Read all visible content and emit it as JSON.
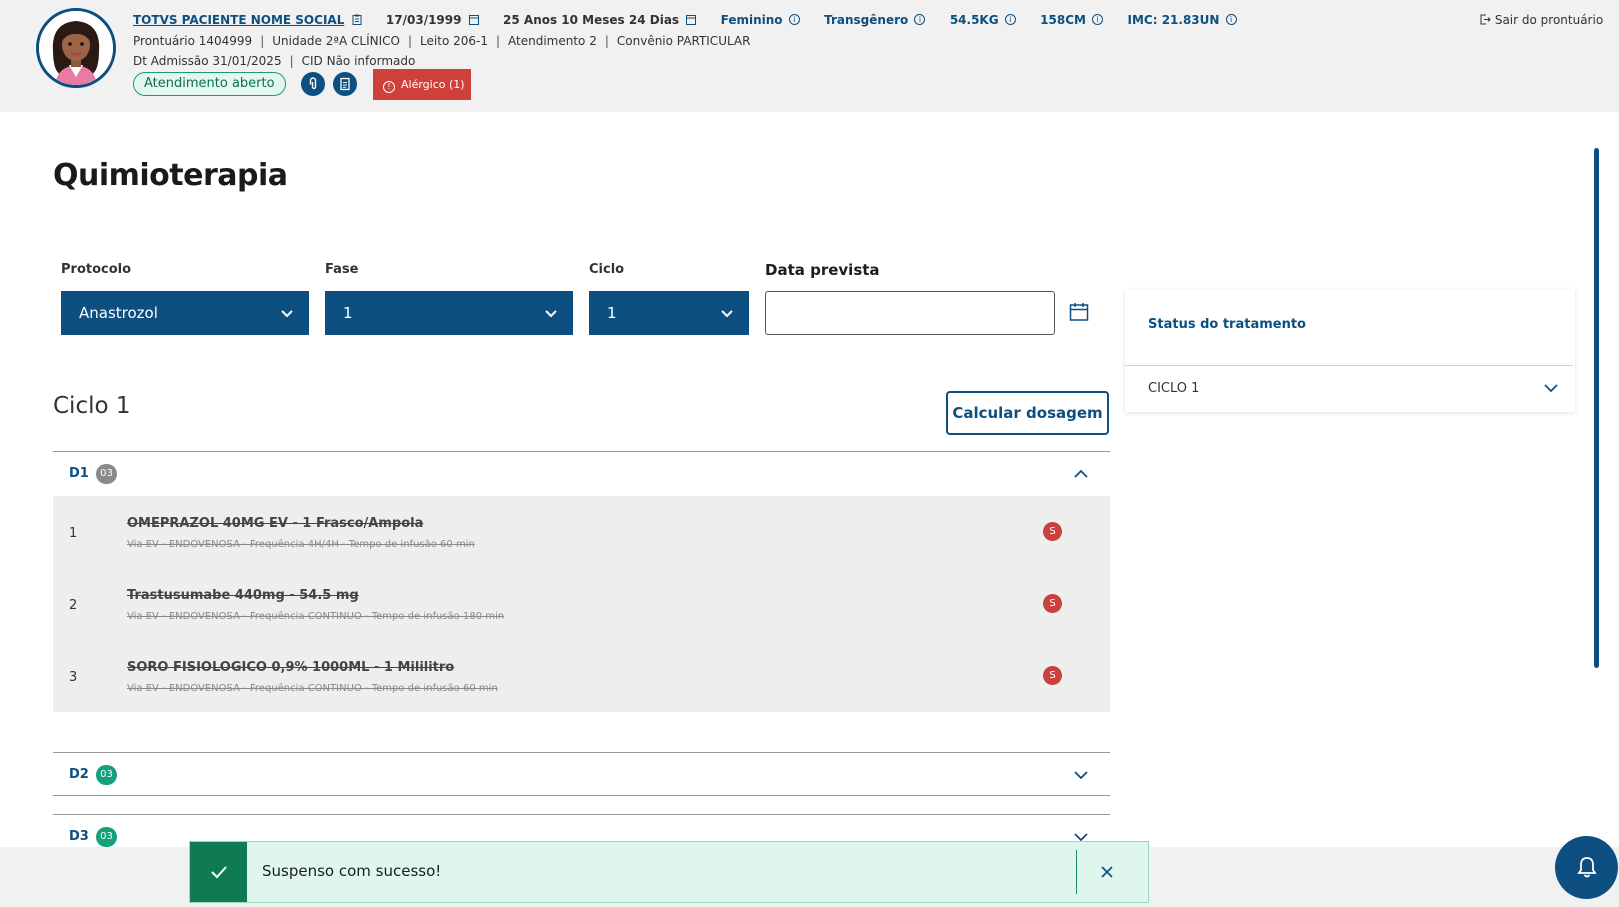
{
  "patient": {
    "name": "TOTVS PACIENTE NOME SOCIAL",
    "birth_date": "17/03/1999",
    "age": "25 Anos 10 Meses 24 Dias",
    "sex": "Feminino",
    "gender": "Transgênero",
    "weight": "54.5KG",
    "height": "158CM",
    "imc": "IMC: 21.83UN",
    "prontuario": "Prontuário 1404999",
    "unidade": "Unidade 2ªA CLÍNICO",
    "leito": "Leito 206-1",
    "atendimento": "Atendimento 2",
    "convenio": "Convênio PARTICULAR",
    "admissao": "Dt Admissão 31/01/2025",
    "cid": "CID Não informado",
    "status": "Atendimento aberto",
    "allergy": "Alérgico (1)"
  },
  "header": {
    "exit_label": "Sair do prontuário"
  },
  "page": {
    "title": "Quimioterapia"
  },
  "form": {
    "protocolo": {
      "label": "Protocolo",
      "value": "Anastrozol"
    },
    "fase": {
      "label": "Fase",
      "value": "1"
    },
    "ciclo": {
      "label": "Ciclo",
      "value": "1"
    },
    "data_prevista": {
      "label": "Data prevista",
      "value": ""
    }
  },
  "status_panel": {
    "title": "Status do tratamento",
    "row": "CICLO 1"
  },
  "cycle": {
    "title": "Ciclo 1",
    "calc_button": "Calcular dosagem",
    "days": [
      {
        "label": "D1",
        "count": "03",
        "expanded": true,
        "badge_color": "#8a8a8a"
      },
      {
        "label": "D2",
        "count": "03",
        "expanded": false,
        "badge_color": "#14a07a"
      },
      {
        "label": "D3",
        "count": "03",
        "expanded": false,
        "badge_color": "#14a07a"
      }
    ],
    "medications": [
      {
        "num": "1",
        "name": "OMEPRAZOL 40MG EV - 1 Frasco/Ampola",
        "detail": "Via EV - ENDOVENOSA - Frequência 4H/4H - Tempo de infusão 60 min",
        "status": "S"
      },
      {
        "num": "2",
        "name": "Trastusumabe 440mg - 54.5 mg",
        "detail": "Via EV - ENDOVENOSA - Frequência CONTINUO - Tempo de infusão 180 min",
        "status": "S"
      },
      {
        "num": "3",
        "name": "SORO FISIOLOGICO 0,9% 1000ML - 1 Mililitro",
        "detail": "Via EV - ENDOVENOSA - Frequência CONTINUO - Tempo de infusão 60 min",
        "status": "S"
      }
    ]
  },
  "toast": {
    "message": "Suspenso com sucesso!",
    "icon": "check-icon"
  },
  "colors": {
    "primary": "#0c4f80",
    "success": "#0f7b53",
    "danger": "#c9403c"
  }
}
